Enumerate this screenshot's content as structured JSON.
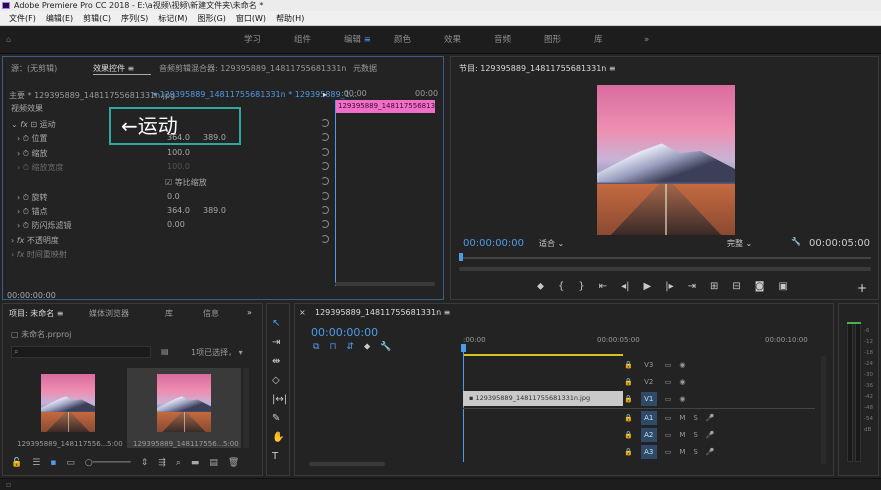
{
  "titlebar": {
    "app": "Adobe Premiere Pro CC 2018 - E:\\a视频\\视频\\新建文件夹\\未命名 *"
  },
  "menu": [
    "文件(F)",
    "编辑(E)",
    "剪辑(C)",
    "序列(S)",
    "标记(M)",
    "图形(G)",
    "窗口(W)",
    "帮助(H)"
  ],
  "workspaces": {
    "items": [
      "学习",
      "组件",
      "编辑",
      "颜色",
      "效果",
      "音频",
      "图形",
      "库"
    ],
    "active": "编辑",
    "more": "»"
  },
  "effect_controls": {
    "tabs": [
      "源：(无剪辑)",
      "效果控件",
      "音频剪辑混合器: 129395889_14811755681331n",
      "元数据"
    ],
    "master": "主要 * 129395889_14811755681331n.jpg",
    "sequence": "129395889_14811755681331n * 129395889_1...",
    "clip_label": "129395889_14811755681331n.jpg",
    "section": "视频效果",
    "timecode_start": ":00:00",
    "timecode_end": "00:00",
    "props": [
      {
        "name": "运动",
        "value1": "",
        "value2": ""
      },
      {
        "name": "位置",
        "value1": "364.0",
        "value2": "389.0"
      },
      {
        "name": "缩放",
        "value1": "100.0",
        "value2": ""
      },
      {
        "name": "缩放宽度",
        "value1": "100.0",
        "value2": ""
      },
      {
        "name": "等比缩放",
        "value1": "",
        "value2": ""
      },
      {
        "name": "旋转",
        "value1": "0.0",
        "value2": ""
      },
      {
        "name": "锚点",
        "value1": "364.0",
        "value2": "389.0"
      },
      {
        "name": "防闪烁滤镜",
        "value1": "0.00",
        "value2": ""
      },
      {
        "name": "不透明度",
        "value1": "",
        "value2": ""
      },
      {
        "name": "时间重映射",
        "value1": "",
        "value2": ""
      }
    ],
    "annotation": "←运动",
    "timecode": "00:00:00:00"
  },
  "program": {
    "title": "节目: 129395889_14811755681331n",
    "timecode": "00:00:00:00",
    "fit": "适合",
    "quality": "完整",
    "duration": "00:00:05:00"
  },
  "project": {
    "tabs": [
      "项目: 未命名",
      "媒体浏览器",
      "库",
      "信息"
    ],
    "file": "未命名.prproj",
    "selection": "1项已选择，",
    "items": [
      {
        "name": "129395889_148117556...",
        "duration": "5:00"
      },
      {
        "name": "129395889_148117556...",
        "duration": "5:00"
      }
    ]
  },
  "timeline": {
    "tab": "129395889_14811755681331n",
    "timecode": "00:00:00:00",
    "ruler": [
      ":00:00",
      "00:00:05:00",
      "00:00:10:00"
    ],
    "tracks": [
      "V3",
      "V2",
      "V1",
      "A1",
      "A2",
      "A3"
    ],
    "clip": "129395889_14811755681331n.jpg",
    "meter_labels": [
      "-6",
      "-12",
      "-18",
      "-24",
      "-30",
      "-36",
      "-42",
      "-48",
      "-54",
      "dB"
    ]
  },
  "colors": {
    "accent": "#4f9bea",
    "clip": "#f06ec8",
    "annotation": "#2ea89f",
    "video_track": "#2f4a66"
  }
}
